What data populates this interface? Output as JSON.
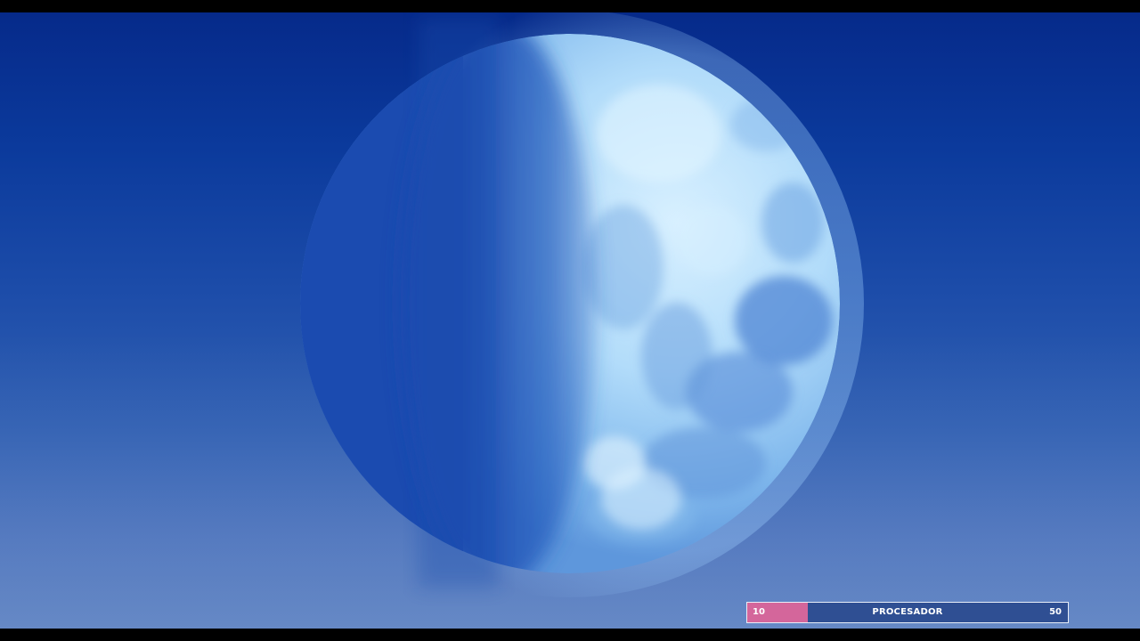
{
  "scene": {
    "sky_top_color": "#062a8a",
    "sky_bottom_color": "#5a80c0",
    "moon_color": "#a8d4f6",
    "moon_phase": "waxing"
  },
  "hud": {
    "left_value": "10",
    "label": "PROCESADOR",
    "right_value": "50",
    "fill_fraction": 0.19,
    "fill_color": "#d4669b",
    "bar_color": "#2f4f93"
  }
}
